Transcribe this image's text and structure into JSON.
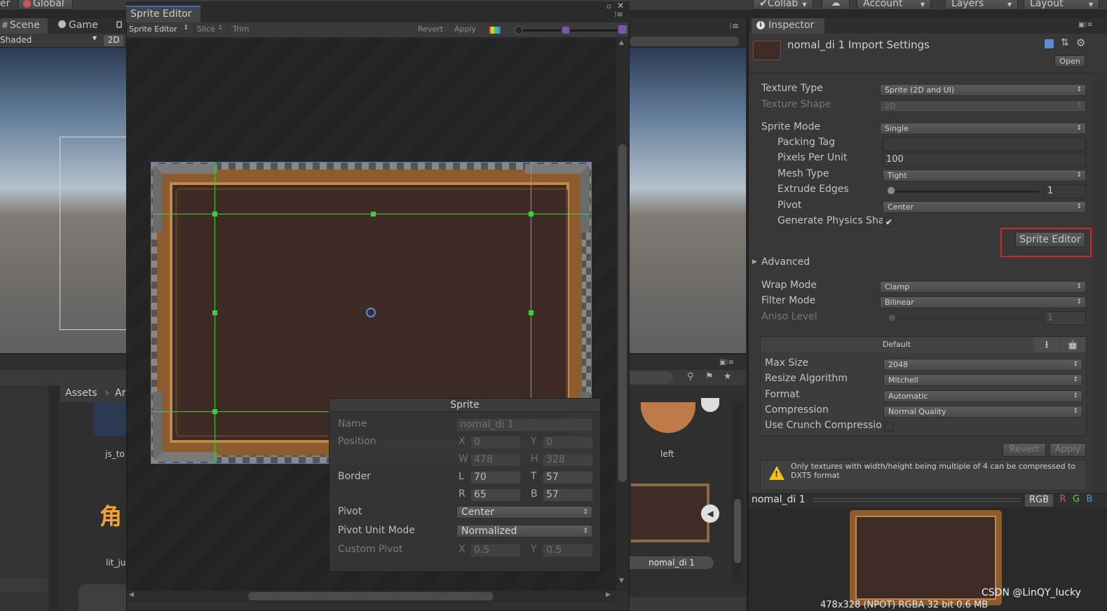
{
  "toolbar": {
    "left_clip": "er",
    "global": "Global",
    "collab": "Collab",
    "account": "Account",
    "layers": "Layers",
    "layout": "Layout"
  },
  "scene": {
    "tab_scene": "Scene",
    "tab_game": "Game",
    "shaded": "Shaded",
    "mode_2d": "2D"
  },
  "project": {
    "breadcrumb_assets": "Assets",
    "breadcrumb_next": "Ar",
    "items": [
      "js_to",
      "lit_ju",
      "left",
      "nomal_di 1"
    ],
    "chinese_glyph": "角"
  },
  "sprite_editor": {
    "title": "Sprite Editor",
    "toolbar": {
      "mode": "Sprite Editor",
      "slice": "Slice",
      "trim": "Trim",
      "revert": "Revert",
      "apply": "Apply"
    },
    "panel": {
      "title": "Sprite",
      "name_label": "Name",
      "name_value": "nomal_di 1",
      "position_label": "Position",
      "x": "0",
      "y": "0",
      "w": "478",
      "h": "328",
      "border_label": "Border",
      "l": "70",
      "t": "57",
      "r": "65",
      "b": "57",
      "pivot_label": "Pivot",
      "pivot_value": "Center",
      "pivot_unit_label": "Pivot Unit Mode",
      "pivot_unit_value": "Normalized",
      "custom_pivot_label": "Custom Pivot",
      "cx": "0.5",
      "cy": "0.5",
      "axis": {
        "x": "X",
        "y": "Y",
        "w": "W",
        "h": "H",
        "l": "L",
        "t": "T",
        "r": "R",
        "b": "B"
      }
    }
  },
  "inspector": {
    "tab": "Inspector",
    "title": "nomal_di 1 Import Settings",
    "open": "Open",
    "texture_type_label": "Texture Type",
    "texture_type": "Sprite (2D and UI)",
    "texture_shape_label": "Texture Shape",
    "texture_shape": "2D",
    "sprite_mode_label": "Sprite Mode",
    "sprite_mode": "Single",
    "packing_tag_label": "Packing Tag",
    "packing_tag": "",
    "ppu_label": "Pixels Per Unit",
    "ppu": "100",
    "mesh_type_label": "Mesh Type",
    "mesh_type": "Tight",
    "extrude_label": "Extrude Edges",
    "extrude": "1",
    "pivot_label": "Pivot",
    "pivot": "Center",
    "physics_label": "Generate Physics Sha",
    "physics_checked": true,
    "sprite_editor_button": "Sprite Editor",
    "advanced": "Advanced",
    "wrap_label": "Wrap Mode",
    "wrap": "Clamp",
    "filter_label": "Filter Mode",
    "filter": "Bilinear",
    "aniso_label": "Aniso Level",
    "aniso": "1",
    "platform_default": "Default",
    "max_size_label": "Max Size",
    "max_size": "2048",
    "resize_label": "Resize Algorithm",
    "resize": "Mitchell",
    "format_label": "Format",
    "format": "Automatic",
    "compression_label": "Compression",
    "compression": "Normal Quality",
    "crunch_label": "Use Crunch Compressio",
    "revert": "Revert",
    "apply": "Apply",
    "warning": "Only textures with width/height being multiple of 4 can be compressed to DXT5 format"
  },
  "preview": {
    "name": "nomal_di 1",
    "rgb": "RGB",
    "r": "R",
    "g": "G",
    "b": "B",
    "info": "478x328 (NPOT)  RGBA 32 bit   0.6 MB"
  },
  "watermark": "CSDN @LinQY_lucky",
  "colors": {
    "accent_red": "#e02020",
    "slice_green": "#3dd23d",
    "warning_yellow": "#f2c21a"
  }
}
